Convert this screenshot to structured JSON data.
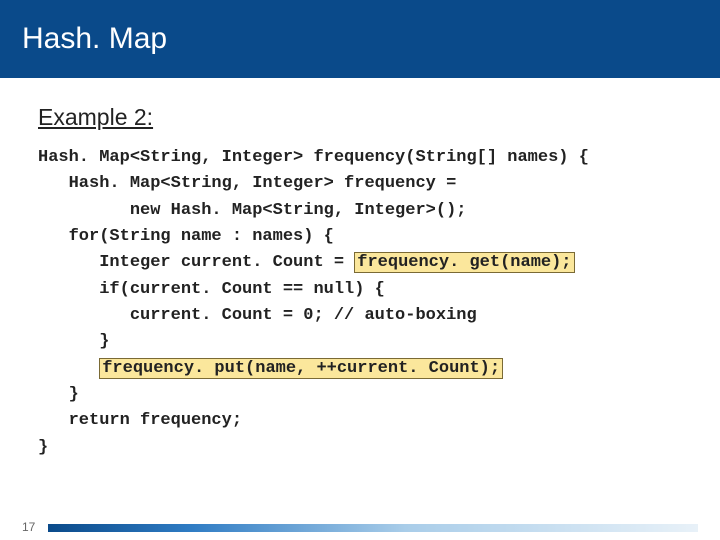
{
  "title": "Hash. Map",
  "example_heading": "Example 2:",
  "code": {
    "l1": "Hash. Map<String, Integer> frequency(String[] names) {",
    "l2": "   Hash. Map<String, Integer> frequency =",
    "l3": "         new Hash. Map<String, Integer>();",
    "l4": "   for(String name : names) {",
    "l5a": "      Integer current. Count = ",
    "hl1": "frequency. get(name);",
    "l6": "      if(current. Count == null) {",
    "l7a": "         current. Count = 0; // ",
    "l7b": "auto-boxing",
    "l8": "      }",
    "l9pad": "      ",
    "hl2": "frequency. put(name, ++current. Count);",
    "l10": "   }",
    "l11": "   return frequency;",
    "l12": "}"
  },
  "page_number": "17"
}
